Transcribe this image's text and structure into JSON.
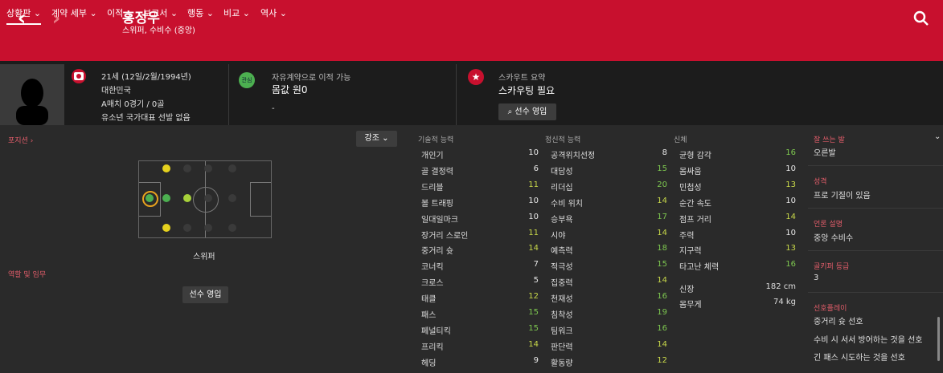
{
  "header": {
    "player_name": "홍정우",
    "player_sub": "스위퍼, 수비수 (중앙)"
  },
  "tabs": [
    "상황판",
    "계약 세부",
    "이적",
    "보고서",
    "행동",
    "비교",
    "역사"
  ],
  "profile": {
    "age_line": "21세 (12일/2월/1994년)",
    "nation": "대한민국",
    "caps": "A매치 0경기 / 0골",
    "youth": "유소년 국가대표 선발 없음"
  },
  "transfer": {
    "badge": "관심",
    "status": "자유계약으로 이적 가능",
    "value": "몸값 원0",
    "extra": "-"
  },
  "scout": {
    "title": "스카우트 요약",
    "summary": "스카우팅 필요",
    "button": "선수 영입"
  },
  "position": {
    "label": "포지션",
    "highlight_btn": "강조",
    "pos_name": "스위퍼",
    "roles_label": "역할 및 임무",
    "sign_button": "선수 영입"
  },
  "attributes": {
    "technical_title": "기술적 능력",
    "mental_title": "정신적 능력",
    "physical_title": "신체",
    "technical": [
      {
        "name": "개인기",
        "value": "10"
      },
      {
        "name": "골 결정력",
        "value": "6"
      },
      {
        "name": "드리블",
        "value": "11"
      },
      {
        "name": "볼 트래핑",
        "value": "10"
      },
      {
        "name": "일대일마크",
        "value": "10"
      },
      {
        "name": "장거리 스로인",
        "value": "11"
      },
      {
        "name": "중거리 슛",
        "value": "14"
      },
      {
        "name": "코너킥",
        "value": "7"
      },
      {
        "name": "크로스",
        "value": "5"
      },
      {
        "name": "태클",
        "value": "12"
      },
      {
        "name": "패스",
        "value": "15"
      },
      {
        "name": "페널티킥",
        "value": "15"
      },
      {
        "name": "프리킥",
        "value": "14"
      },
      {
        "name": "헤딩",
        "value": "9"
      }
    ],
    "mental": [
      {
        "name": "공격위치선정",
        "value": "8"
      },
      {
        "name": "대담성",
        "value": "15"
      },
      {
        "name": "리더십",
        "value": "20"
      },
      {
        "name": "수비 위치",
        "value": "14"
      },
      {
        "name": "승부욕",
        "value": "17"
      },
      {
        "name": "시야",
        "value": "14"
      },
      {
        "name": "예측력",
        "value": "18"
      },
      {
        "name": "적극성",
        "value": "15"
      },
      {
        "name": "집중력",
        "value": "14"
      },
      {
        "name": "천재성",
        "value": "16"
      },
      {
        "name": "침착성",
        "value": "19"
      },
      {
        "name": "팀워크",
        "value": "16"
      },
      {
        "name": "판단력",
        "value": "14"
      },
      {
        "name": "활동량",
        "value": "12"
      }
    ],
    "physical": [
      {
        "name": "균형 감각",
        "value": "16"
      },
      {
        "name": "몸싸움",
        "value": "10"
      },
      {
        "name": "민첩성",
        "value": "13"
      },
      {
        "name": "순간 속도",
        "value": "10"
      },
      {
        "name": "점프 거리",
        "value": "14"
      },
      {
        "name": "주력",
        "value": "10"
      },
      {
        "name": "지구력",
        "value": "13"
      },
      {
        "name": "타고난 체력",
        "value": "16"
      }
    ],
    "height_label": "신장",
    "height_value": "182 cm",
    "weight_label": "몸무게",
    "weight_value": "74 kg"
  },
  "side": {
    "foot_label": "잘 쓰는 발",
    "foot_value": "오른발",
    "personality_label": "성격",
    "personality_value": "프로 기질이 있음",
    "media_label": "언론 설명",
    "media_value": "중앙 수비수",
    "grade_label": "골키퍼 등급",
    "grade_value": "3",
    "prefs_label": "선호플레이",
    "prefs": [
      "중거리 슛 선호",
      "수비 시 서서 방어하는 것을 선호",
      "긴 패스 시도하는 것을 선호"
    ]
  },
  "colors": {
    "accent": "#c8102e",
    "green": "#4caf50",
    "yellow": "#e6d21e"
  }
}
